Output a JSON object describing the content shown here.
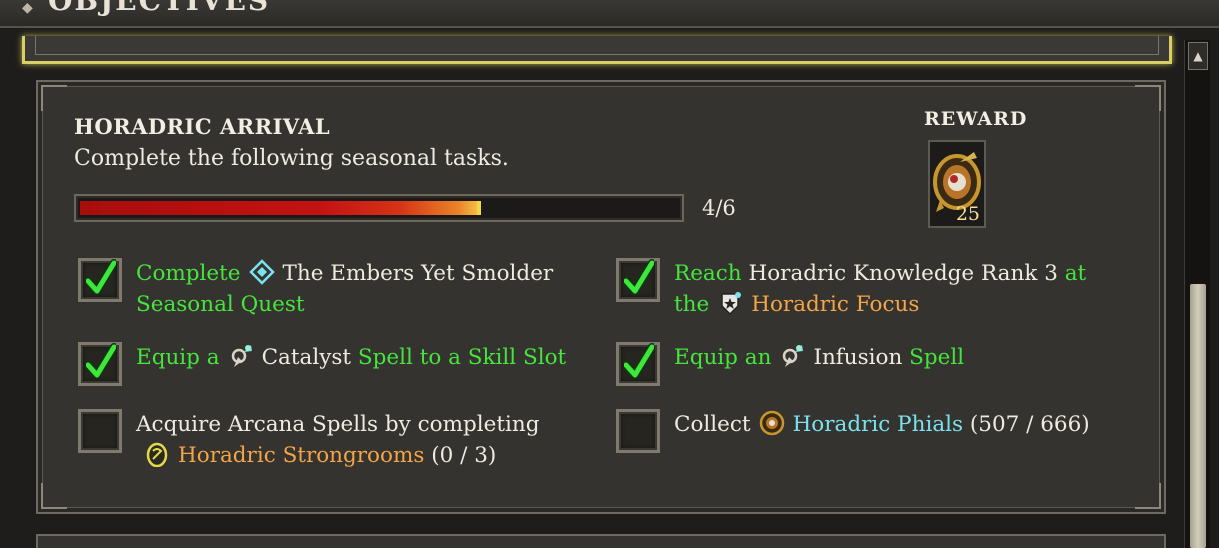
{
  "header": {
    "title": "OBJECTIVES"
  },
  "objective": {
    "title": "HORADRIC ARRIVAL",
    "description": "Complete the following seasonal tasks.",
    "progress": {
      "current": 4,
      "total": 6,
      "label": "4/6",
      "fraction": 0.667
    },
    "reward": {
      "label": "REWARD",
      "count": "25",
      "icon": "horadric-phial-icon"
    }
  },
  "tasks": [
    {
      "completed": true,
      "parts": [
        {
          "text": "Complete",
          "color": "green"
        },
        {
          "icon": "seasonal-quest-icon"
        },
        {
          "text": "The Embers Yet Smolder",
          "color": "white"
        },
        {
          "text": "Seasonal Quest",
          "color": "green"
        }
      ]
    },
    {
      "completed": true,
      "parts": [
        {
          "text": "Reach",
          "color": "green"
        },
        {
          "text": "Horadric Knowledge Rank 3",
          "color": "white"
        },
        {
          "text": "at the",
          "color": "green"
        },
        {
          "icon": "horadric-focus-icon"
        },
        {
          "text": "Horadric Focus",
          "color": "orange"
        }
      ]
    },
    {
      "completed": true,
      "parts": [
        {
          "text": "Equip a",
          "color": "green"
        },
        {
          "icon": "catalyst-spell-icon"
        },
        {
          "text": "Catalyst",
          "color": "white"
        },
        {
          "text": "Spell to a Skill Slot",
          "color": "green"
        }
      ]
    },
    {
      "completed": true,
      "parts": [
        {
          "text": "Equip an",
          "color": "green"
        },
        {
          "icon": "infusion-spell-icon"
        },
        {
          "text": "Infusion",
          "color": "white"
        },
        {
          "text": "Spell",
          "color": "green"
        }
      ]
    },
    {
      "completed": false,
      "parts": [
        {
          "text": "Acquire Arcana Spells by completing",
          "color": "white"
        },
        {
          "icon": "strongroom-icon"
        },
        {
          "text": "Horadric Strongrooms",
          "color": "orange"
        },
        {
          "text": "(0 / 3)",
          "color": "white"
        }
      ]
    },
    {
      "completed": false,
      "parts": [
        {
          "text": "Collect",
          "color": "white"
        },
        {
          "icon": "horadric-phial-icon"
        },
        {
          "text": "Horadric Phials",
          "color": "cyan"
        },
        {
          "text": "(507 / 666)",
          "color": "white"
        }
      ]
    }
  ],
  "scrollbar": {
    "up_icon": "triangle-up-icon"
  },
  "colors": {
    "green": "#45e53d",
    "orange": "#f4a547",
    "cyan": "#7ae2ee",
    "white": "#efebe0",
    "highlight": "#d8d067"
  }
}
